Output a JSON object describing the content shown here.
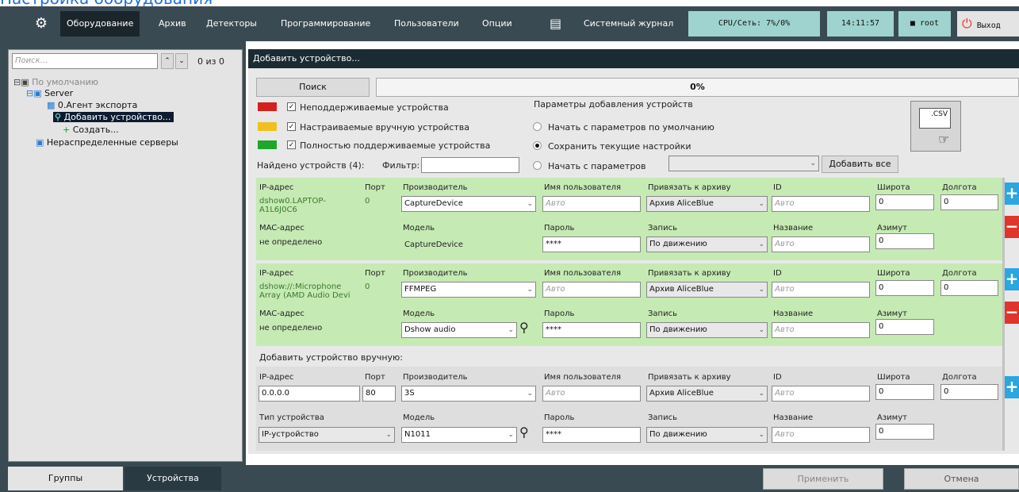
{
  "page_caption": "Настройка оборудования",
  "menu": {
    "gear": "⚙",
    "items": [
      "Оборудование",
      "Архив",
      "Детекторы",
      "Программирование",
      "Пользователи",
      "Опции"
    ],
    "syslog": "Системный журнал",
    "cpu": "CPU/Сеть: 7%/0%",
    "time": "14:11:57",
    "user": "root",
    "exit": "Выход"
  },
  "left": {
    "search_placeholder": "Поиск...",
    "counter": "0 из 0",
    "tree": {
      "root": "По умолчанию",
      "server": "Server",
      "export": "0.Агент экспорта",
      "add": "Добавить устройство...",
      "create": "Создать...",
      "unassigned": "Нераспределенные серверы"
    },
    "tabs": [
      "Группы",
      "Устройства"
    ]
  },
  "right": {
    "title": "Добавить устройство...",
    "search_btn": "Поиск",
    "progress": "0%",
    "progress_value": 0,
    "filters": [
      "Неподдерживаемые устройства",
      "Настраиваемые вручную устройства",
      "Полностью поддерживаемые устройства"
    ],
    "found": "Найдено устройств (4):",
    "filter_label": "Фильтр:",
    "params_title": "Параметры добавления устройств",
    "params": [
      "Начать с параметров по умолчанию",
      "Сохранить текущие настройки",
      "Начать с параметров"
    ],
    "csv": ".CSV",
    "add_all": "Добавить все",
    "labels": {
      "ip": "IP-адрес",
      "port": "Порт",
      "vendor": "Производитель",
      "user": "Имя пользователя",
      "archive": "Привязать к архиву",
      "id": "ID",
      "lat": "Широта",
      "lon": "Долгота",
      "mac": "MAC-адрес",
      "model": "Модель",
      "pass": "Пароль",
      "rec": "Запись",
      "name": "Название",
      "az": "Азимут",
      "devtype": "Тип устройства",
      "auto": "Авто"
    },
    "dev1": {
      "ip": "dshow0.LAPTOP-A1L6J0C6",
      "port": "0",
      "vendor": "CaptureDevice",
      "archive": "Архив AliceBlue",
      "lat": "0",
      "lon": "0",
      "mac": "не определено",
      "model": "CaptureDevice",
      "pass": "****",
      "rec": "По движению",
      "az": "0"
    },
    "dev2": {
      "ip": "dshow://:Microphone Array (AMD Audio Devi",
      "port": "0",
      "vendor": "FFMPEG",
      "archive": "Архив AliceBlue",
      "lat": "0",
      "lon": "0",
      "mac": "не определено",
      "model": "Dshow audio",
      "pass": "****",
      "rec": "По движению",
      "az": "0"
    },
    "manual_title": "Добавить устройство вручную:",
    "dev3": {
      "ip": "0.0.0.0",
      "port": "80",
      "vendor": "3S",
      "archive": "Архив AliceBlue",
      "lat": "0",
      "lon": "0",
      "devtype": "IP-устройство",
      "model": "N1011",
      "pass": "****",
      "rec": "По движению",
      "az": "0"
    },
    "apply": "Применить",
    "cancel": "Отмена"
  },
  "colors": {
    "bar": "#3a4a52",
    "green": "#c6eab4",
    "plus": "#2aa6e0",
    "minus": "#e0352b"
  }
}
